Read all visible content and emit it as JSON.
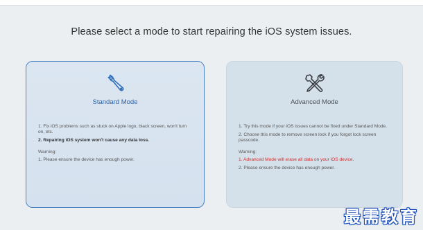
{
  "heading": "Please select a mode to start repairing the iOS system issues.",
  "standard": {
    "title": "Standard Mode",
    "icon": "wrench-icon",
    "items": [
      "1. Fix iOS problems such as stuck on Apple logo, black screen, won't turn on, etc.",
      "2. Repairing iOS system won't cause any data loss."
    ],
    "warning_label": "Warning:",
    "warnings": [
      "1. Please ensure the device has enough power."
    ]
  },
  "advanced": {
    "title": "Advanced Mode",
    "icon": "tools-icon",
    "items": [
      "1. Try this mode if your iOS issues cannot be fixed under Standard Mode.",
      "2. Choose this mode to remove screen lock if you forgot lock screen passcode."
    ],
    "warning_label": "Warning:",
    "warnings": [
      "1. Advanced Mode will erase all data on your iOS device.",
      "2. Please ensure the device has enough power."
    ]
  },
  "watermark": "最需教育",
  "colors": {
    "accent": "#2862a8",
    "danger": "#d12b2b"
  }
}
